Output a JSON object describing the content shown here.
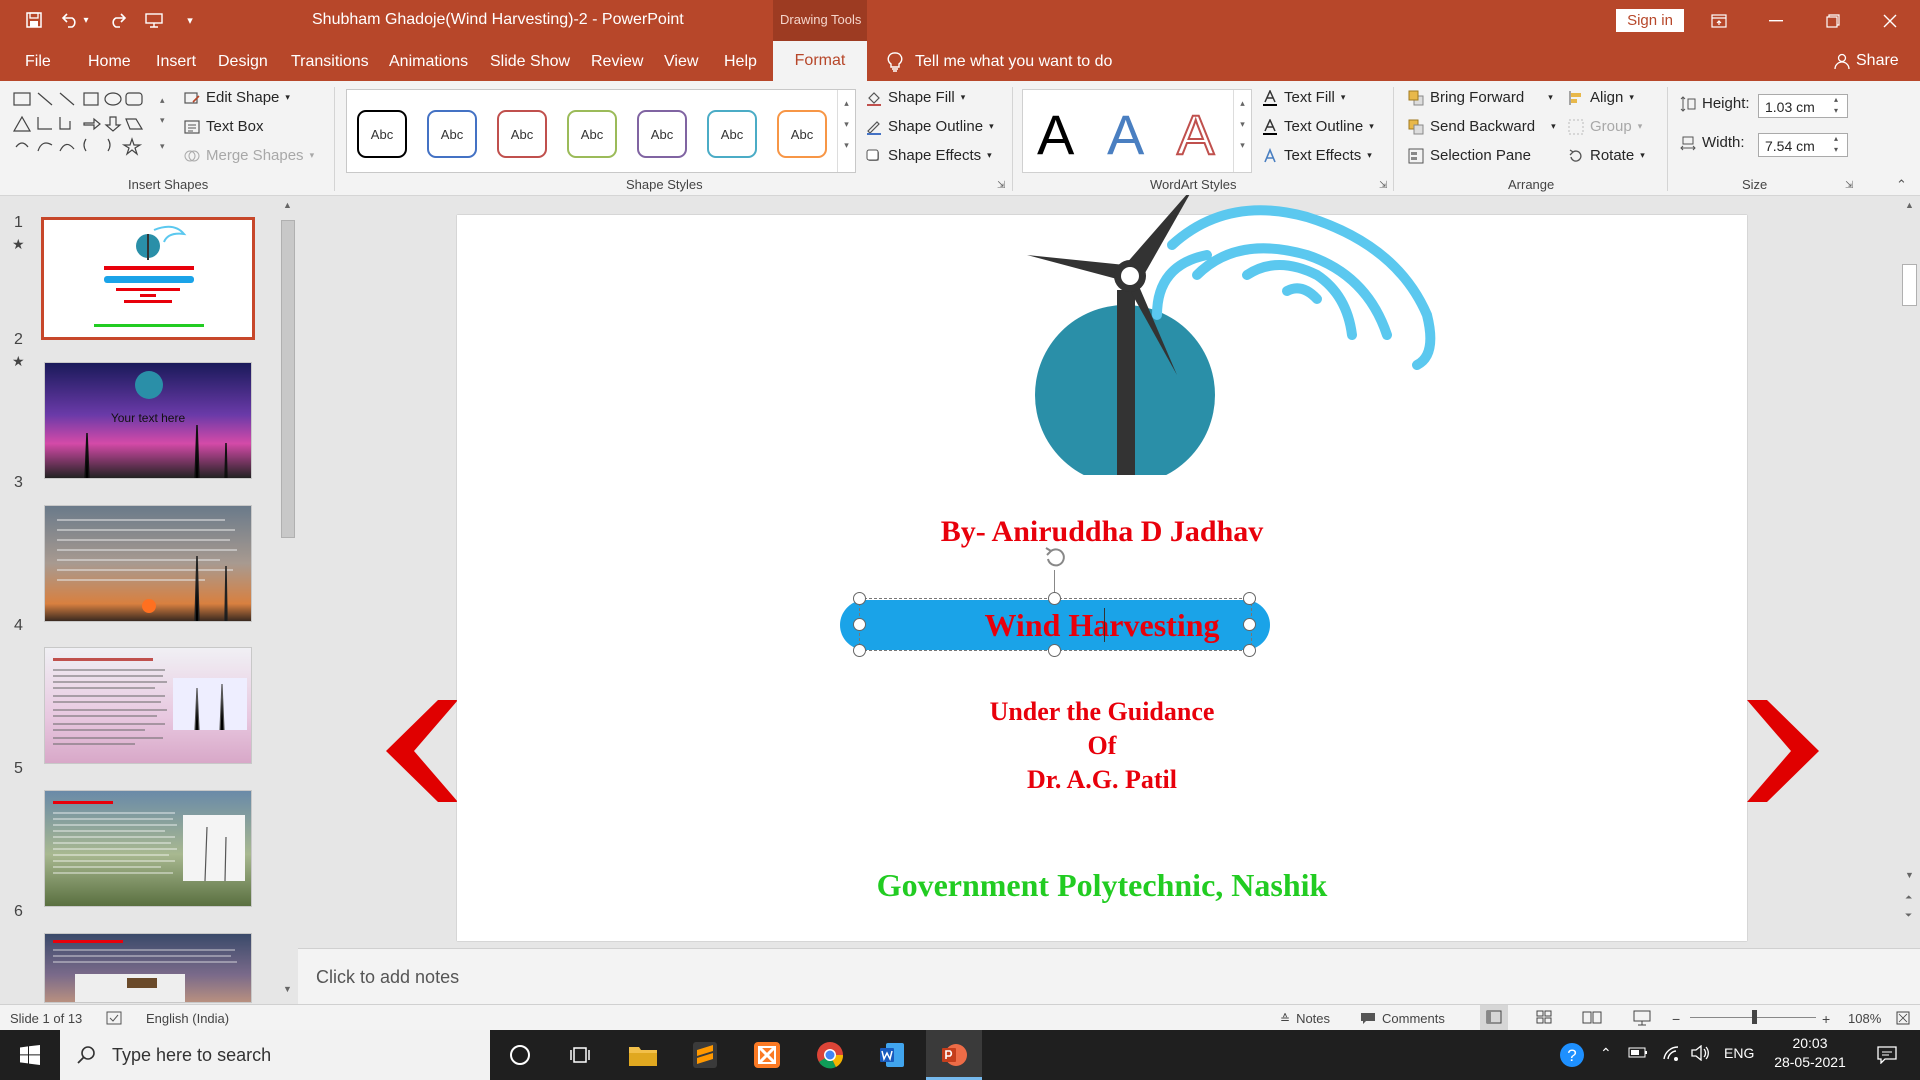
{
  "titlebar": {
    "doc_title": "Shubham Ghadoje(Wind Harvesting)-2  -  PowerPoint",
    "context_label": "Drawing Tools",
    "sign_in": "Sign in"
  },
  "tabs": [
    "File",
    "Home",
    "Insert",
    "Design",
    "Transitions",
    "Animations",
    "Slide Show",
    "Review",
    "View",
    "Help"
  ],
  "active_tab": "Format",
  "tell_me": "Tell me what you want to do",
  "share": "Share",
  "ribbon": {
    "insert_shapes": {
      "label": "Insert Shapes",
      "edit_shape": "Edit Shape",
      "text_box": "Text Box",
      "merge_shapes": "Merge Shapes"
    },
    "shape_styles": {
      "label": "Shape Styles",
      "swatch_text": "Abc",
      "swatch_colors": [
        "#000000",
        "#4472c4",
        "#c0504d",
        "#9bbb59",
        "#8064a2",
        "#4bacc6",
        "#f79646"
      ],
      "shape_fill": "Shape Fill",
      "shape_outline": "Shape Outline",
      "shape_effects": "Shape Effects"
    },
    "wordart_styles": {
      "label": "WordArt Styles",
      "sample": "A",
      "text_fill": "Text Fill",
      "text_outline": "Text Outline",
      "text_effects": "Text Effects"
    },
    "arrange": {
      "label": "Arrange",
      "bring_forward": "Bring Forward",
      "send_backward": "Send Backward",
      "selection_pane": "Selection Pane",
      "align": "Align",
      "group": "Group",
      "rotate": "Rotate"
    },
    "size": {
      "label": "Size",
      "height_label": "Height:",
      "height_value": "1.03 cm",
      "width_label": "Width:",
      "width_value": "7.54 cm"
    }
  },
  "thumbnails": [
    {
      "num": "1",
      "star": true
    },
    {
      "num": "2",
      "star": true,
      "text": "Your text here"
    },
    {
      "num": "3",
      "star": false
    },
    {
      "num": "4",
      "star": false
    },
    {
      "num": "5",
      "star": false
    },
    {
      "num": "6",
      "star": false
    }
  ],
  "slide": {
    "author": "By- Aniruddha D Jadhav",
    "title_box": "Wind Harvesting",
    "guidance_1": "Under the Guidance",
    "guidance_2": "Of",
    "guidance_3": "Dr. A.G. Patil",
    "college": "Government Polytechnic, Nashik",
    "colors": {
      "red": "#e8000b",
      "green": "#22cc22",
      "box": "#1aa3e8",
      "logo_circle": "#2a8fa8",
      "wave": "#5bc8ef",
      "arrow": "#e00000"
    }
  },
  "notes_placeholder": "Click to add notes",
  "status": {
    "slide_of": "Slide 1 of 13",
    "language": "English (India)",
    "notes": "Notes",
    "comments": "Comments",
    "zoom": "108%"
  },
  "taskbar": {
    "search_placeholder": "Type here to search",
    "lang": "ENG",
    "time": "20:03",
    "date": "28-05-2021"
  }
}
